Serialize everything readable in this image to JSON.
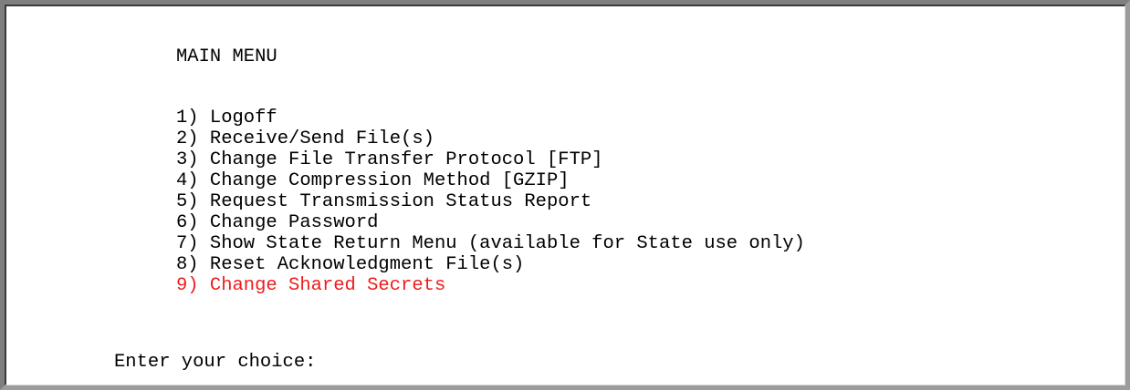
{
  "menu": {
    "title": "MAIN MENU",
    "items": [
      {
        "label": "1) Logoff"
      },
      {
        "label": "2) Receive/Send File(s)"
      },
      {
        "label": "3) Change File Transfer Protocol [FTP]"
      },
      {
        "label": "4) Change Compression Method [GZIP]"
      },
      {
        "label": "5) Request Transmission Status Report"
      },
      {
        "label": "6) Change Password"
      },
      {
        "label": "7) Show State Return Menu (available for State use only)"
      },
      {
        "label": "8) Reset Acknowledgment File(s)"
      },
      {
        "label": "9) Change Shared Secrets"
      }
    ],
    "highlight_color": "#ee1c1c"
  },
  "prompt": {
    "label": "Enter your choice:",
    "value": ""
  }
}
